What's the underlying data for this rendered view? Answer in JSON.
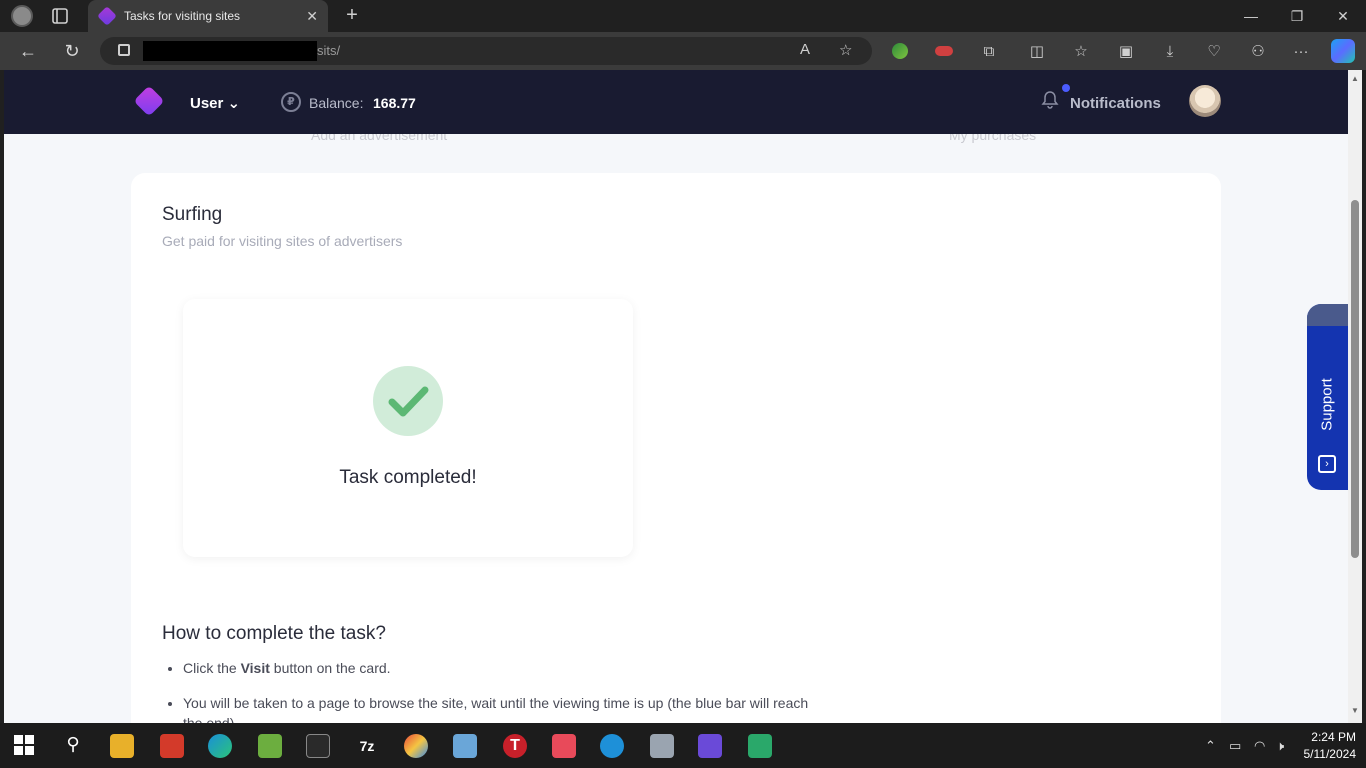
{
  "browser": {
    "tab_title": "Tasks for visiting sites",
    "tab_close": "✕",
    "new_tab": "+",
    "url_suffix": "sits/",
    "min": "—",
    "restore": "❐",
    "close": "✕",
    "back": "←",
    "reload": "↻",
    "read_aloud": "A",
    "favorite": "☆",
    "more": "···"
  },
  "site": {
    "user_label": "User",
    "user_chevron": "⌄",
    "balance_icon": "₽",
    "balance_label": "Balance:",
    "balance_value": "168.77",
    "notifications_label": "Notifications",
    "behind_left": "Add an advertisement",
    "behind_right": "My purchases"
  },
  "card": {
    "title": "Surfing",
    "subtitle": "Get paid for visiting sites of advertisers",
    "task_status": "Task completed!",
    "how_title": "How to complete the task?",
    "steps": [
      {
        "pre": "Click the ",
        "bold": "Visit",
        "post": " button on the card."
      },
      {
        "pre": "You will be taken to a page to browse the site, wait until the viewing time is up (the blue bar will reach the end).",
        "bold": "",
        "post": ""
      }
    ]
  },
  "support": {
    "label": "Support"
  },
  "taskbar": {
    "time": "2:24 PM",
    "date": "5/11/2024"
  },
  "colors": {
    "accent": "#1434b0",
    "nav_bg": "#191b31",
    "success": "#5cb874"
  }
}
